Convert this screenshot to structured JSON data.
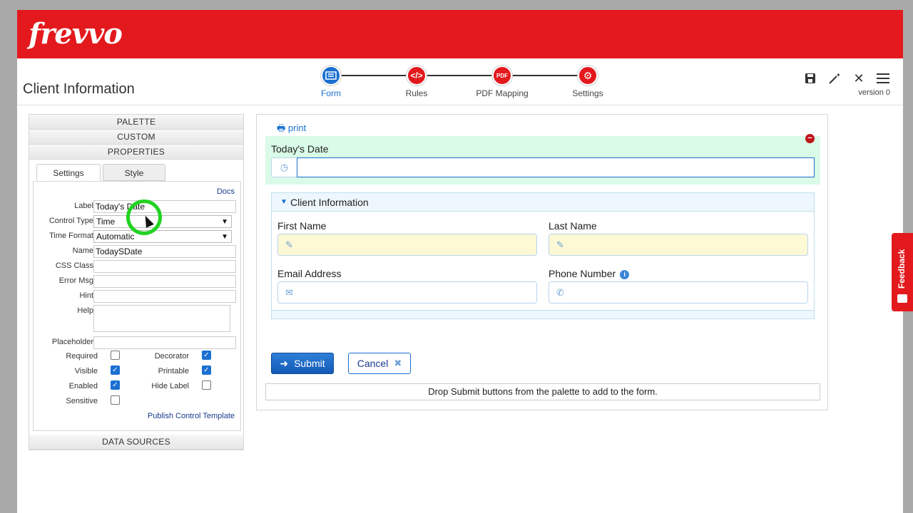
{
  "brand": {
    "logo": "frevvo"
  },
  "header": {
    "title": "Client Information",
    "version": "version 0",
    "steps": [
      {
        "label": "Form",
        "icon": "form-icon",
        "color": "#1a6fd1",
        "active": true
      },
      {
        "label": "Rules",
        "icon": "rules-icon",
        "color": "#e3191d"
      },
      {
        "label": "PDF Mapping",
        "icon": "pdf-icon",
        "color": "#e3191d"
      },
      {
        "label": "Settings",
        "icon": "gear-icon",
        "color": "#e3191d"
      }
    ],
    "tools": [
      "save-icon",
      "magic-wand-icon",
      "close-icon",
      "menu-icon"
    ]
  },
  "left": {
    "accordion": {
      "palette": "PALETTE",
      "custom": "CUSTOM",
      "properties": "PROPERTIES",
      "data_sources": "DATA SOURCES"
    },
    "tabs": {
      "settings": "Settings",
      "style": "Style"
    },
    "docs": "Docs",
    "fields": {
      "label": {
        "label": "Label",
        "value": "Today's Date"
      },
      "control_type": {
        "label": "Control Type",
        "value": "Time"
      },
      "time_format": {
        "label": "Time Format",
        "value": "Automatic"
      },
      "name": {
        "label": "Name",
        "value": "TodaySDate"
      },
      "css_class": {
        "label": "CSS Class",
        "value": ""
      },
      "error_msg": {
        "label": "Error Msg",
        "value": ""
      },
      "hint": {
        "label": "Hint",
        "value": ""
      },
      "help": {
        "label": "Help",
        "value": ""
      },
      "placeholder": {
        "label": "Placeholder",
        "value": ""
      }
    },
    "checks": {
      "required": {
        "label": "Required",
        "checked": false
      },
      "decorator": {
        "label": "Decorator",
        "checked": true
      },
      "visible": {
        "label": "Visible",
        "checked": true
      },
      "printable": {
        "label": "Printable",
        "checked": true
      },
      "enabled": {
        "label": "Enabled",
        "checked": true
      },
      "hide_label": {
        "label": "Hide Label",
        "checked": false
      },
      "sensitive": {
        "label": "Sensitive",
        "checked": false
      }
    },
    "publish": "Publish Control Template"
  },
  "canvas": {
    "print": "print",
    "date_label": "Today's Date",
    "section_title": "Client Information",
    "first_name": "First Name",
    "last_name": "Last Name",
    "email": "Email Address",
    "phone": "Phone Number",
    "submit": "Submit",
    "cancel": "Cancel",
    "drop_msg": "Drop Submit buttons from the palette to add to the form."
  },
  "feedback": "Feedback"
}
